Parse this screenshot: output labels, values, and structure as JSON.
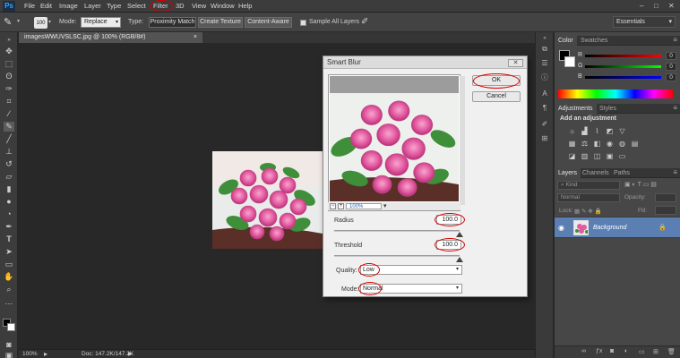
{
  "app": {
    "logo": "Ps"
  },
  "menu": [
    "File",
    "Edit",
    "Image",
    "Layer",
    "Type",
    "Select",
    "Filter",
    "3D",
    "View",
    "Window",
    "Help"
  ],
  "window_controls": [
    "–",
    "□",
    "✕"
  ],
  "options": {
    "brush_size": "100",
    "mode_label": "Mode:",
    "mode_value": "Replace",
    "type_label": "Type:",
    "type_buttons": [
      "Proximity Match",
      "Create Texture",
      "Content-Aware"
    ],
    "sample_all_layers": "Sample All Layers",
    "workspace": "Essentials"
  },
  "document": {
    "tab_title": "imagesWWUVSLSC.jpg @ 100% (RGB/8#)",
    "tab_close": "×",
    "zoom": "100%",
    "doc_size": "Doc: 147.2K/147.2K"
  },
  "dialog": {
    "title": "Smart Blur",
    "close": "✕",
    "ok_label": "OK",
    "cancel_label": "Cancel",
    "zoom_value": "100%",
    "zoom_out": "−",
    "zoom_in": "+",
    "radius_label": "Radius",
    "radius_value": "100.0",
    "radius_level": 1.0,
    "threshold_label": "Threshold",
    "threshold_value": "100.0",
    "threshold_level": 1.0,
    "quality_label": "Quality:",
    "quality_value": "Low",
    "mode_label": "Mode:",
    "mode_value": "Normal"
  },
  "color_panel": {
    "tabs": [
      "Color",
      "Swatches"
    ],
    "channels": [
      {
        "label": "R",
        "value": "0"
      },
      {
        "label": "G",
        "value": "0"
      },
      {
        "label": "B",
        "value": "0"
      }
    ]
  },
  "adjustments_panel": {
    "tabs": [
      "Adjustments",
      "Styles"
    ],
    "heading": "Add an adjustment"
  },
  "layers_panel": {
    "tabs": [
      "Layers",
      "Channels",
      "Paths"
    ],
    "kind": "Kind",
    "blend_mode": "Normal",
    "opacity_label": "Opacity:",
    "lock_label": "Lock:",
    "fill_label": "Fill:",
    "layer_name": "Background"
  },
  "colors": {
    "accent_red": "#d60000",
    "layer_selected": "#5b7fb3",
    "rose_pink": "#e35aa0",
    "leaf_green": "#3f8f3a"
  }
}
